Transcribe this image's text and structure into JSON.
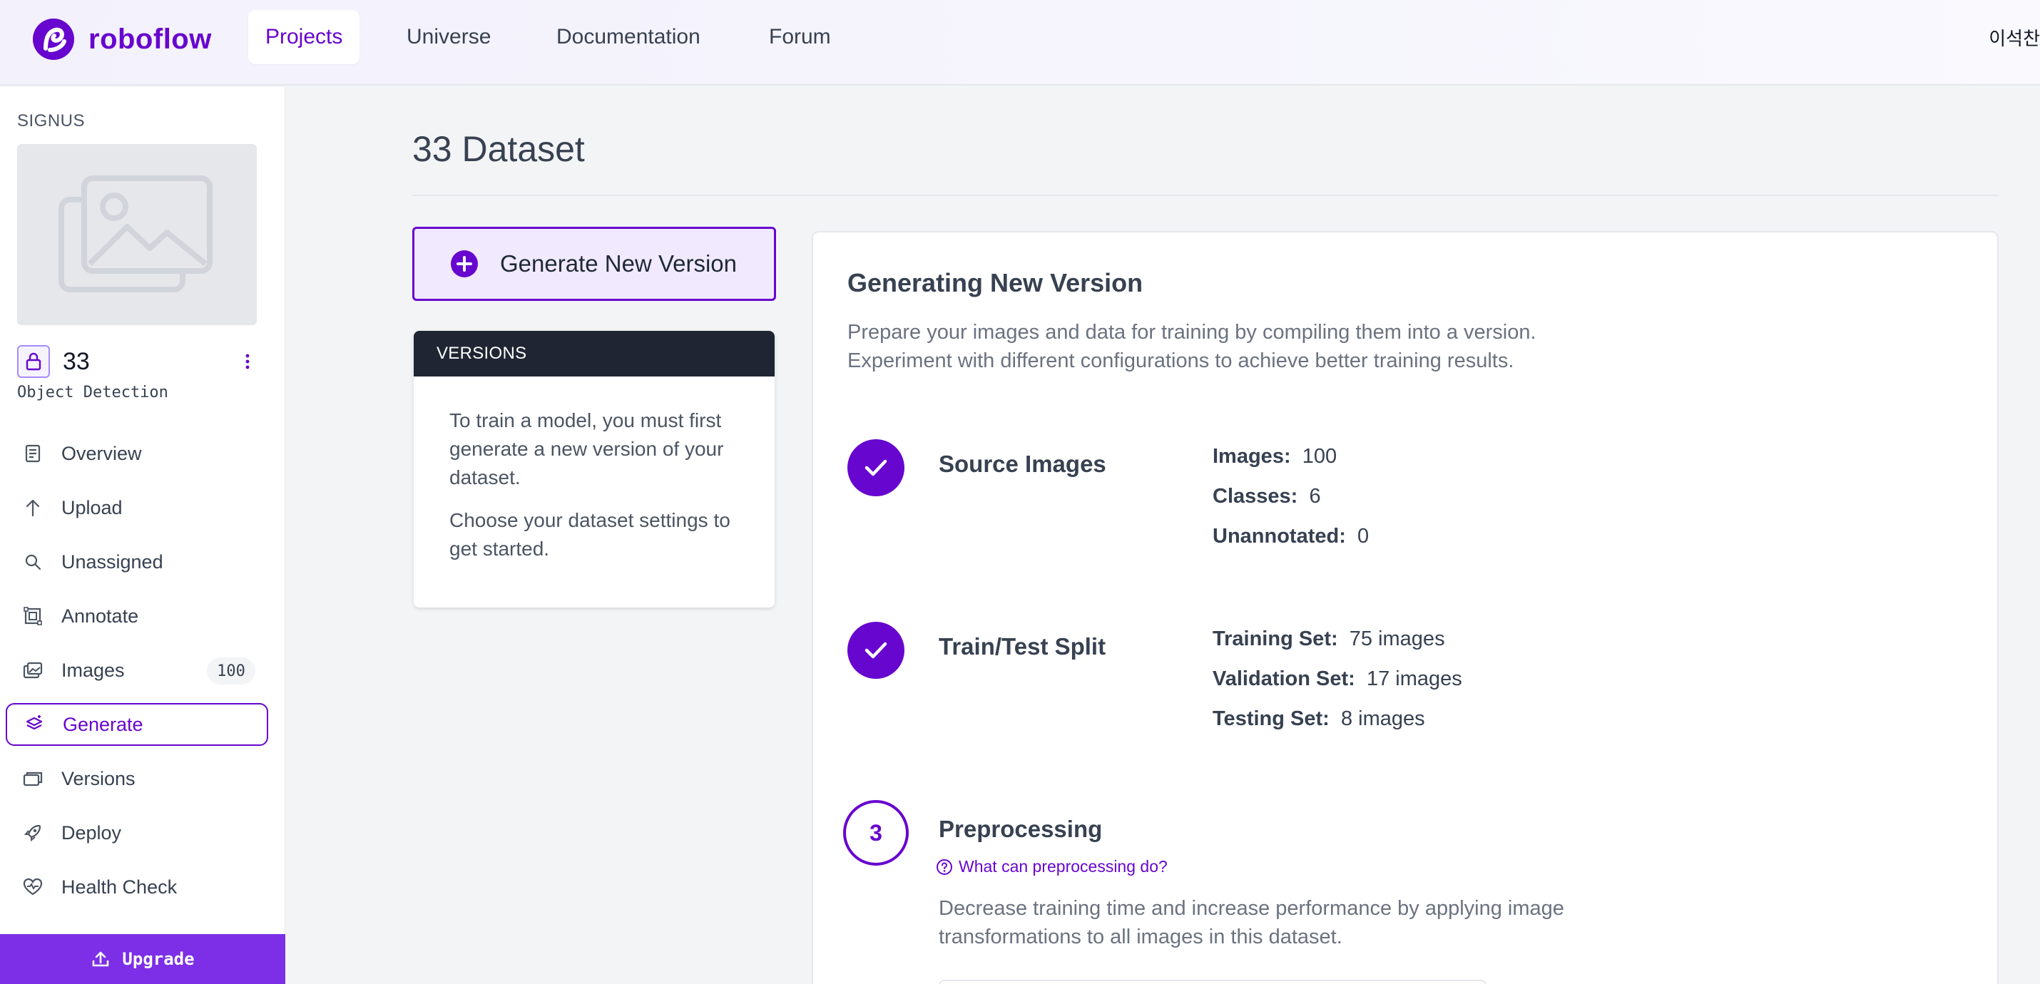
{
  "brand": {
    "name": "roboflow",
    "accent": "#6706ce"
  },
  "topnav": {
    "items": [
      {
        "label": "Projects",
        "active": true
      },
      {
        "label": "Universe"
      },
      {
        "label": "Documentation"
      },
      {
        "label": "Forum"
      }
    ],
    "user": "이석찬"
  },
  "sidebar": {
    "workspace": "SIGNUS",
    "project": {
      "name": "33",
      "type": "Object Detection"
    },
    "items": [
      {
        "label": "Overview",
        "icon": "document-icon"
      },
      {
        "label": "Upload",
        "icon": "arrow-up-icon"
      },
      {
        "label": "Unassigned",
        "icon": "search-icon"
      },
      {
        "label": "Annotate",
        "icon": "annotate-frame-icon"
      },
      {
        "label": "Images",
        "icon": "images-icon",
        "count": "100"
      },
      {
        "label": "Generate",
        "icon": "generate-icon",
        "active": true
      },
      {
        "label": "Versions",
        "icon": "versions-stack-icon"
      },
      {
        "label": "Deploy",
        "icon": "rocket-icon"
      },
      {
        "label": "Health Check",
        "icon": "heart-pulse-icon"
      }
    ],
    "upgrade_label": "Upgrade"
  },
  "main": {
    "title": "33 Dataset",
    "generate_button": "Generate New Version",
    "versions": {
      "header": "VERSIONS",
      "body1": "To train a model, you must first generate a new version of your dataset.",
      "body2": "Choose your dataset settings to get started."
    },
    "card": {
      "title": "Generating New Version",
      "desc_line1": "Prepare your images and data for training by compiling them into a version.",
      "desc_line2": "Experiment with different configurations to achieve better training results.",
      "steps": {
        "source": {
          "title": "Source Images",
          "stats": [
            {
              "label": "Images:",
              "value": "100"
            },
            {
              "label": "Classes:",
              "value": "6"
            },
            {
              "label": "Unannotated:",
              "value": "0"
            }
          ]
        },
        "split": {
          "title": "Train/Test Split",
          "stats": [
            {
              "label": "Training Set:",
              "value": "75 images"
            },
            {
              "label": "Validation Set:",
              "value": "17 images"
            },
            {
              "label": "Testing Set:",
              "value": "8 images"
            }
          ]
        },
        "preprocessing": {
          "number": "3",
          "title": "Preprocessing",
          "help": "What can preprocessing do?",
          "desc_line1": "Decrease training time and increase performance by applying image",
          "desc_line2": "transformations to all images in this dataset."
        }
      }
    }
  }
}
